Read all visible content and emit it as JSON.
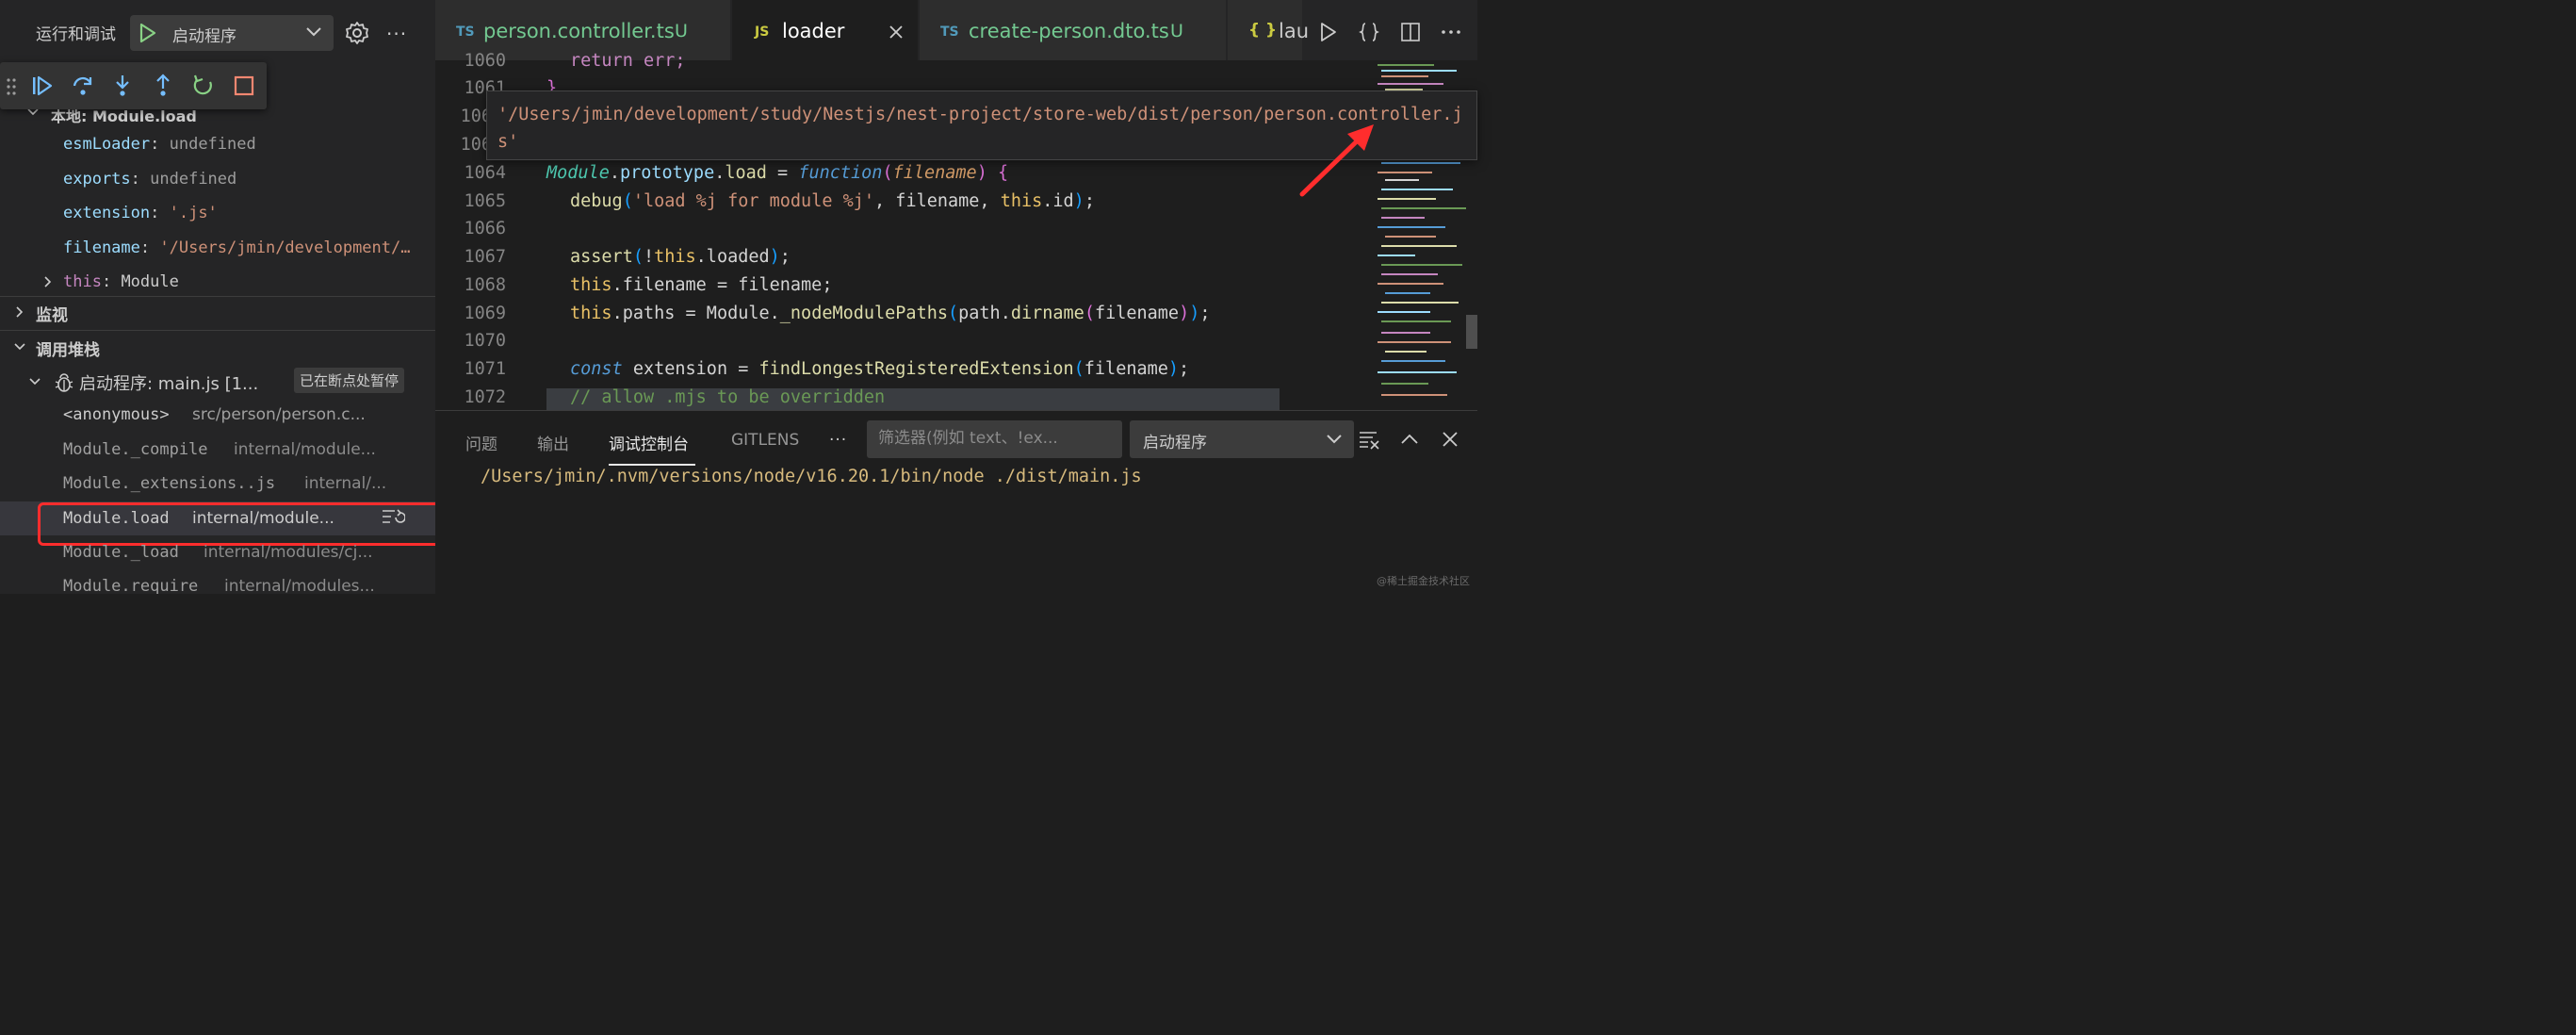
{
  "sidebar": {
    "title": "运行和调试",
    "launch_config": "启动程序",
    "more": "···",
    "variables": {
      "scope_title": "本地: Module.load",
      "items": [
        {
          "name": "esmLoader",
          "sep": ": ",
          "value": "undefined"
        },
        {
          "name": "exports",
          "sep": ": ",
          "value": "undefined"
        },
        {
          "name": "extension",
          "sep": ": ",
          "value": "'.js'"
        },
        {
          "name": "filename",
          "sep": ": ",
          "value": "'/Users/jmin/development/…"
        },
        {
          "name": "this",
          "sep": ": ",
          "value": "Module"
        }
      ]
    },
    "watch_title": "监视",
    "callstack_title": "调用堆栈",
    "thread": {
      "label": "启动程序: main.js [1...",
      "badge": "已在断点处暂停"
    },
    "frames": [
      {
        "fn": "<anonymous>",
        "src": "src/person/person.c..."
      },
      {
        "fn": "Module._compile",
        "src": "internal/module..."
      },
      {
        "fn": "Module._extensions..js",
        "src": "internal/..."
      },
      {
        "fn": "Module.load",
        "src": "internal/module..."
      },
      {
        "fn": "Module._load",
        "src": "internal/modules/cj..."
      },
      {
        "fn": "Module.require",
        "src": "internal/modules..."
      }
    ]
  },
  "tabs": [
    {
      "lang": "TS",
      "name": "person.controller.ts",
      "badge": "U"
    },
    {
      "lang": "JS",
      "name": "loader"
    },
    {
      "lang": "TS",
      "name": "create-person.dto.ts",
      "badge": "U"
    },
    {
      "lang": "{ }",
      "name": "lau"
    }
  ],
  "editor": {
    "line_numbers": [
      "1060",
      "1061",
      "106",
      "106",
      "1064",
      "1065",
      "1066",
      "1067",
      "1068",
      "1069",
      "1070",
      "1071",
      "1072"
    ],
    "code_text": {
      "l1060": "return err;",
      "l1061": "}",
      "l1065_str": "'load %j for module %j'",
      "l1072": "// allow .mjs to be overridden"
    },
    "hover_value": "'/Users/jmin/development/study/Nestjs/nest-project/store-web/dist/person/person.controller.js'"
  },
  "panel": {
    "tabs": [
      "问题",
      "输出",
      "调试控制台",
      "GITLENS"
    ],
    "more": "···",
    "filter_placeholder": "筛选器(例如 text、!ex...",
    "console_select": "启动程序",
    "output": "/Users/jmin/.nvm/versions/node/v16.20.1/bin/node ./dist/main.js"
  },
  "watermark": "@稀土掘金技术社区",
  "colors": {
    "accent_green": "#89d185",
    "highlight_red": "#ff2d2d",
    "string": "#ce9178"
  }
}
